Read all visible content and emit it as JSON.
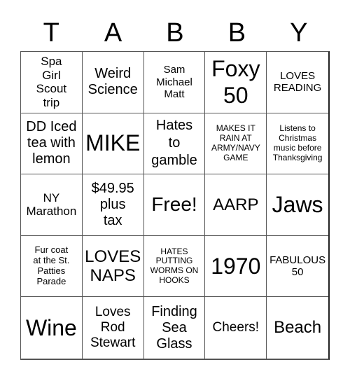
{
  "title_letters": [
    "T",
    "A",
    "B",
    "B",
    "Y"
  ],
  "cells": [
    "Spa Girl Scout trip",
    "Weird Science",
    "Sam Michael Matt",
    "Foxy 50",
    "LOVES READING",
    "DD Iced tea with lemon",
    "MIKE",
    "Hates to gamble",
    "MAKES IT RAIN AT ARMY/NAVY GAME",
    "Listens to Christmas music before Thanksgiving",
    "NY Marathon",
    "$49.95 plus tax",
    "Free!",
    "AARP",
    "Jaws",
    "Fur coat at the St. Patties Parade",
    "LOVES NAPS",
    "HATES PUTTING WORMS ON HOOKS",
    "1970",
    "FABULOUS 50",
    "Wine",
    "Loves Rod Stewart",
    "Finding Sea Glass",
    "Cheers!",
    "Beach"
  ]
}
